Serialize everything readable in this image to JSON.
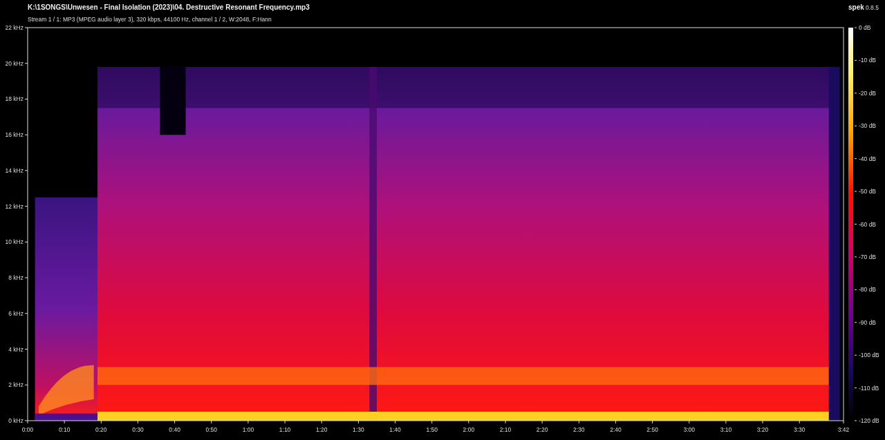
{
  "title": "K:\\1SONGS\\Unwesen - Final Isolation (2023)\\04. Destructive Resonant Frequency.mp3",
  "stream_info": "Stream 1 / 1: MP3 (MPEG audio layer 3), 320 kbps, 44100 Hz, channel 1 / 2, W:2048, F:Hann",
  "app": {
    "name": "spek",
    "version": "0.8.5"
  },
  "frequency_axis": {
    "ticks": [
      "22 kHz",
      "20 kHz",
      "18 kHz",
      "16 kHz",
      "14 kHz",
      "12 kHz",
      "10 kHz",
      "8 kHz",
      "6 kHz",
      "4 kHz",
      "2 kHz",
      "0 kHz"
    ]
  },
  "time_axis": {
    "ticks": [
      "0:00",
      "0:10",
      "0:20",
      "0:30",
      "0:40",
      "0:50",
      "1:00",
      "1:10",
      "1:20",
      "1:30",
      "1:40",
      "1:50",
      "2:00",
      "2:10",
      "2:20",
      "2:30",
      "2:40",
      "2:50",
      "3:00",
      "3:10",
      "3:20",
      "3:30",
      "3:42"
    ]
  },
  "color_scale": {
    "ticks": [
      "0 dB",
      "-10 dB",
      "-20 dB",
      "-30 dB",
      "-40 dB",
      "-50 dB",
      "-60 dB",
      "-70 dB",
      "-80 dB",
      "-90 dB",
      "-100 dB",
      "-110 dB",
      "-120 dB"
    ]
  }
}
